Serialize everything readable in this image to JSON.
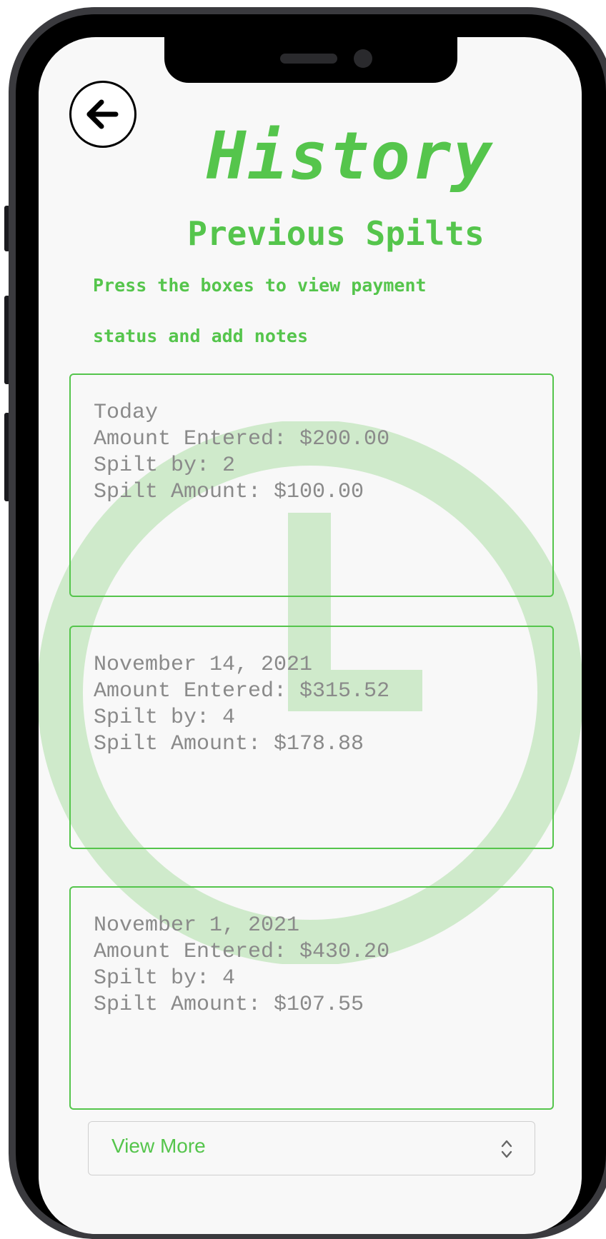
{
  "header": {
    "title": "History",
    "subtitle": "Previous Spilts",
    "instruction_line1": "Press the boxes to view payment",
    "instruction_line2": "status and add notes"
  },
  "history": [
    {
      "date": "Today",
      "amount_entered": "Amount Entered: $200.00",
      "split_by": "Spilt by: 2",
      "split_amount": "Spilt Amount: $100.00"
    },
    {
      "date": "November 14, 2021",
      "amount_entered": "Amount Entered: $315.52",
      "split_by": "Spilt by: 4",
      "split_amount": "Spilt Amount: $178.88"
    },
    {
      "date": "November 1, 2021",
      "amount_entered": "Amount Entered: $430.20",
      "split_by": "Spilt by: 4",
      "split_amount": "Spilt Amount: $107.55"
    }
  ],
  "view_more": {
    "label": "View More",
    "icon": "chevron-up-down-icon"
  },
  "icons": {
    "back": "arrow-left-icon",
    "watermark": "clock-icon"
  },
  "colors": {
    "accent": "#55c54c",
    "watermark": "#cfeacb",
    "card_text": "#8a8a8a",
    "screen_bg": "#f8f8f8"
  }
}
